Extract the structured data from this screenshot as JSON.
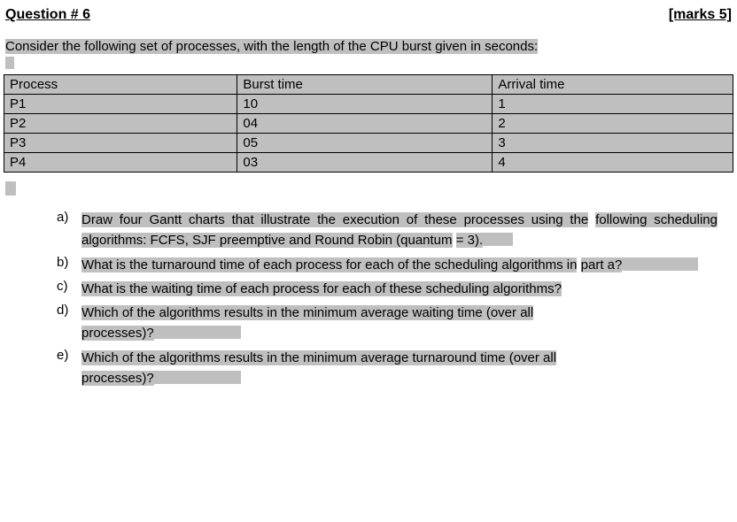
{
  "header": {
    "question_label": "Question # 6",
    "marks_label": "[marks 5]"
  },
  "intro": "Consider the following set of processes, with the length of the CPU burst given in seconds:",
  "table": {
    "headers": {
      "c1": "Process",
      "c2": "Burst time",
      "c3": "Arrival time"
    },
    "rows": [
      {
        "c1": "P1",
        "c2": "10",
        "c3": "1"
      },
      {
        "c1": "P2",
        "c2": "04",
        "c3": "2"
      },
      {
        "c1": "P3",
        "c2": "05",
        "c3": "3"
      },
      {
        "c1": "P4",
        "c2": "03",
        "c3": "4"
      }
    ]
  },
  "parts": {
    "a": {
      "label": "a)",
      "t1": "Draw four Gantt charts that illustrate the execution of these processes using the",
      "t2": "following scheduling algorithms: FCFS, SJF preemptive and Round Robin (quantum",
      "t3": "= 3)."
    },
    "b": {
      "label": "b)",
      "t1": " What is the turnaround time of each process for each of the scheduling algorithms in",
      "t2": "part a?"
    },
    "c": {
      "label": "c)",
      "t1": "What is the waiting time of each process for each of these scheduling algorithms?"
    },
    "d": {
      "label": "d)",
      "t1": " Which of the algorithms results in the minimum average waiting time (over all",
      "t2": "processes)?"
    },
    "e": {
      "label": "e)",
      "t1": " Which of the algorithms results in the minimum average turnaround time (over all",
      "t2": "processes)?"
    }
  }
}
